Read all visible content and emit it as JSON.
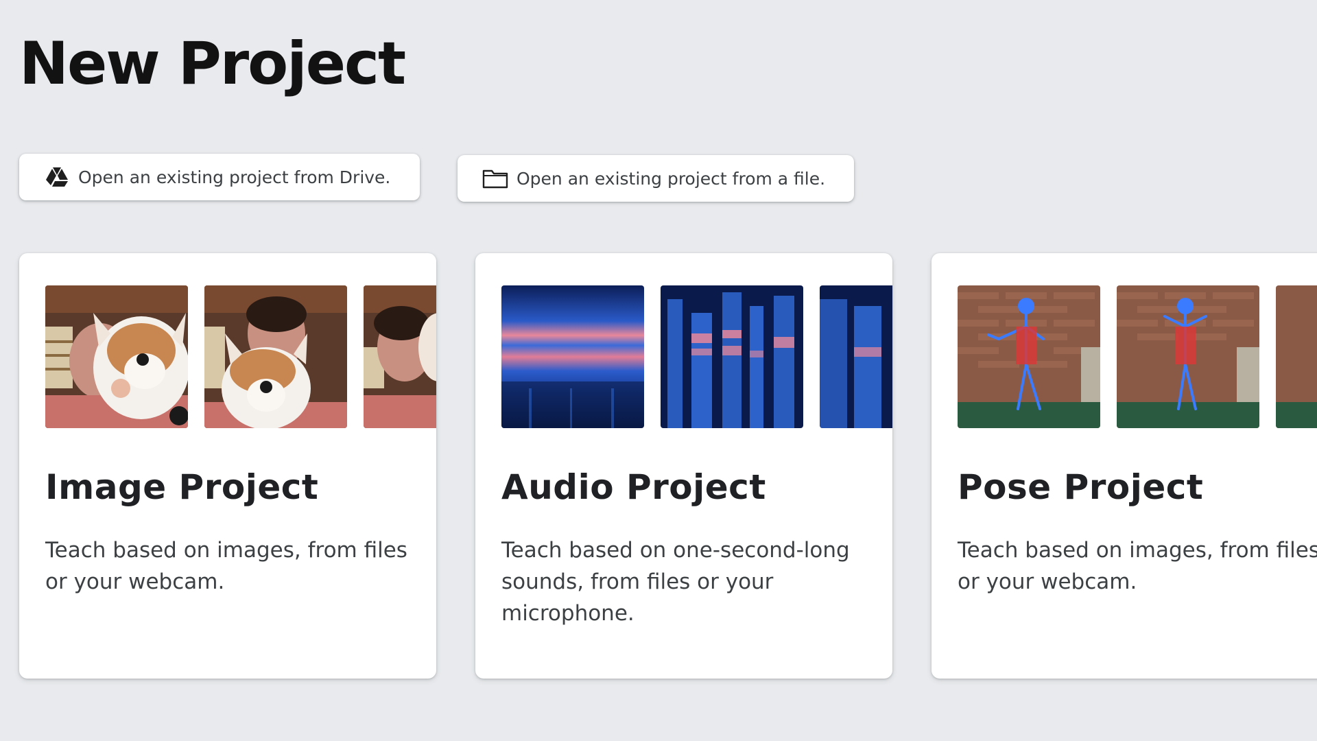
{
  "page": {
    "title": "New Project"
  },
  "open_actions": {
    "drive": {
      "label": "Open an existing project from Drive.",
      "icon": "google-drive-icon"
    },
    "file": {
      "label": "Open an existing project from a file.",
      "icon": "folder-icon"
    }
  },
  "projects": [
    {
      "title": "Image Project",
      "description": "Teach based on images, from files or your webcam.",
      "thumbnails": [
        "plush-corgi-photo",
        "plush-corgi-photo",
        "plush-corgi-photo"
      ]
    },
    {
      "title": "Audio Project",
      "description": "Teach based on one-second-long sounds, from files or your microphone.",
      "thumbnails": [
        "spectrogram",
        "spectrogram",
        "spectrogram"
      ]
    },
    {
      "title": "Pose Project",
      "description": "Teach based on images, from files or your webcam.",
      "thumbnails": [
        "pose-skeleton-photo",
        "pose-skeleton-photo",
        "pose-skeleton-photo"
      ]
    }
  ],
  "colors": {
    "background": "#e8eaed",
    "card": "#ffffff",
    "spectrogram_dark": "#0a1a4a",
    "spectrogram_blue": "#2f6bd8",
    "spectrogram_pink": "#e8879a",
    "pose_skeleton": "#3a7bff"
  }
}
